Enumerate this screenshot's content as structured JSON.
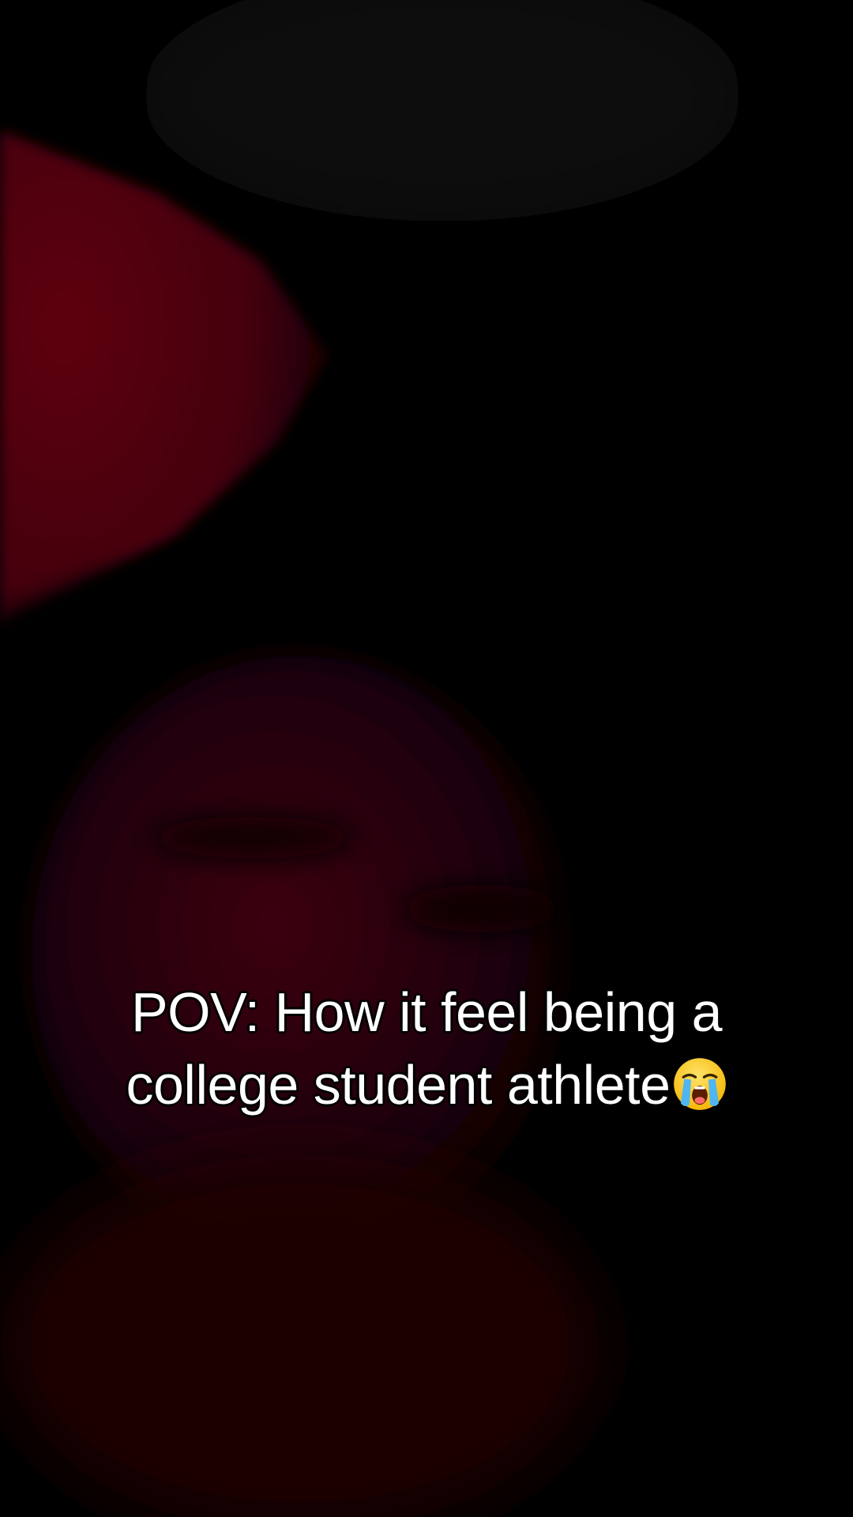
{
  "caption": {
    "line1": "POV: How it feel being a",
    "line2": "college student athlete"
  },
  "emoji": {
    "icon": "loudly-crying-face-icon"
  },
  "colors": {
    "background": "#000000",
    "red_glow": "#6b0010",
    "caption_text": "#ffffff",
    "caption_outline": "#000000"
  }
}
